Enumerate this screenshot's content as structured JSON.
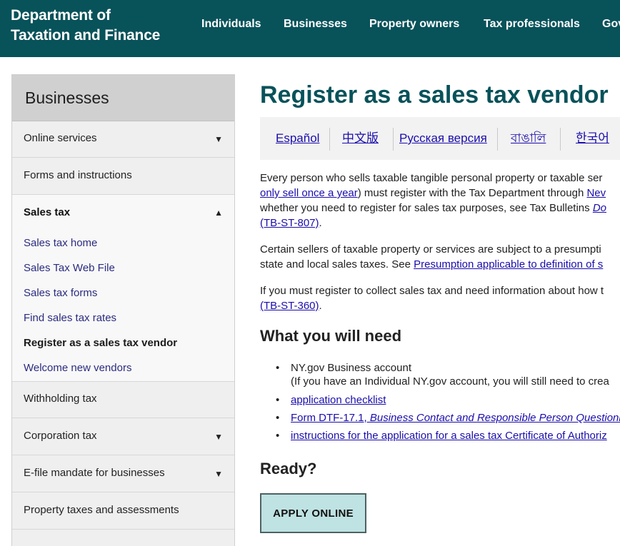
{
  "header": {
    "logo_line1": "Department of",
    "logo_line2": "Taxation and Finance",
    "nav": [
      "Individuals",
      "Businesses",
      "Property owners",
      "Tax professionals",
      "Gov"
    ]
  },
  "sidebar": {
    "title": "Businesses",
    "items": [
      {
        "label": "Online services",
        "caret": "▼"
      },
      {
        "label": "Forms and instructions",
        "caret": ""
      },
      {
        "label": "Sales tax",
        "caret": "▲"
      },
      {
        "label": "Withholding tax",
        "caret": ""
      },
      {
        "label": "Corporation tax",
        "caret": "▼"
      },
      {
        "label": "E-file mandate for businesses",
        "caret": "▼"
      },
      {
        "label": "Property taxes and assessments",
        "caret": ""
      }
    ],
    "sales_tax_sub": [
      "Sales tax home",
      "Sales Tax Web File",
      "Sales tax forms",
      "Find sales tax rates",
      "Register as a sales tax vendor",
      "Welcome new vendors"
    ]
  },
  "main": {
    "title": "Register as a sales tax vendor",
    "languages": [
      "Español",
      "中文版",
      "Русская версия",
      "বাঙালি",
      "한국어"
    ],
    "para1": {
      "l1": "Every person who sells taxable tangible personal property or taxable ser",
      "l2_link1": "only sell once a year",
      "l2_text": ") must register with the Tax Department through ",
      "l2_link2": "Nev",
      "l3_text": "whether you need to register for sales tax purposes, see Tax Bulletins ",
      "l3_link": "Do",
      "l4_link": "(TB-ST-807)",
      "l4_text": "."
    },
    "para2": {
      "l1": "Certain sellers of taxable property or services are subject to a presumpti",
      "l2_text": "state and local sales taxes. See ",
      "l2_link": "Presumption applicable to definition of s"
    },
    "para3": {
      "l1": "If you must register to collect sales tax and need information about how t",
      "l2_link": "(TB-ST-360)",
      "l2_text": "."
    },
    "need_heading": "What you will need",
    "needs": {
      "b1": "NY.gov Business account",
      "b1_sub": "(If you have an Individual NY.gov account, you will still need to crea",
      "b2": "application checklist",
      "b3_link": "Form DTF-17.1,",
      "b3_italic": " Business Contact and Responsible Person Questionn",
      "b4": "instructions for the application for a sales tax Certificate of Authoriz"
    },
    "ready_heading": "Ready?",
    "apply_label": "APPLY ONLINE"
  }
}
